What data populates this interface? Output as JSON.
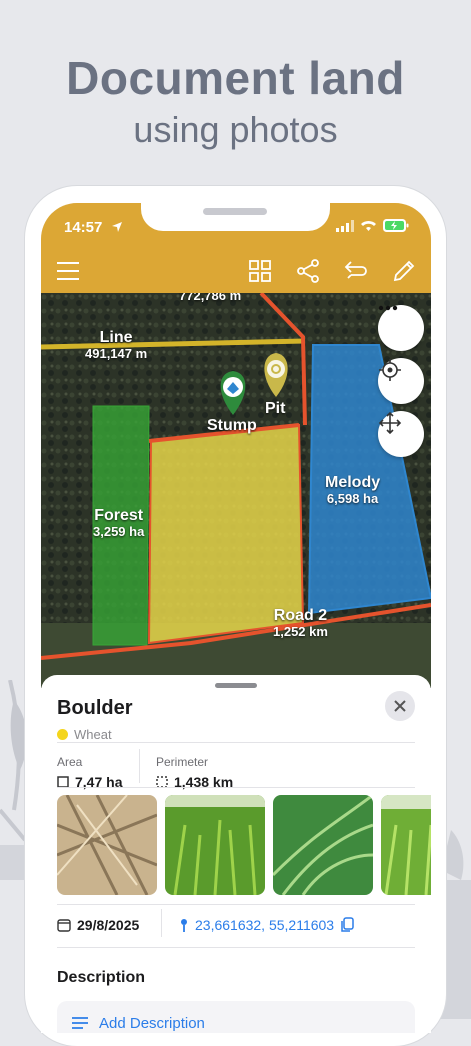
{
  "headline": {
    "line1": "Document land",
    "line2": "using photos"
  },
  "status": {
    "time": "14:57"
  },
  "toolbar": {
    "icons": [
      "menu-icon",
      "grid-icon",
      "share-icon",
      "undo-icon",
      "edit-icon"
    ]
  },
  "map": {
    "labels": {
      "top_value": "772,786 m",
      "line_name": "Line",
      "line_value": "491,147 m",
      "pit": "Pit",
      "stump": "Stump",
      "forest_name": "Forest",
      "forest_value": "3,259 ha",
      "melody_name": "Melody",
      "melody_value": "6,598 ha",
      "road_name": "Road 2",
      "road_value": "1,252 km"
    },
    "colors": {
      "yellow": "#f3e14a",
      "blue": "#2f86cf",
      "green": "#37a536",
      "line": "#d3b42a",
      "road": "#e5532d"
    }
  },
  "sheet": {
    "title": "Boulder",
    "crop": "Wheat",
    "area_label": "Area",
    "area_value": "7,47 ha",
    "perimeter_label": "Perimeter",
    "perimeter_value": "1,438 km",
    "date": "29/8/2025",
    "coords": "23,661632, 55,211603",
    "description_heading": "Description",
    "add_description": "Add Description"
  }
}
